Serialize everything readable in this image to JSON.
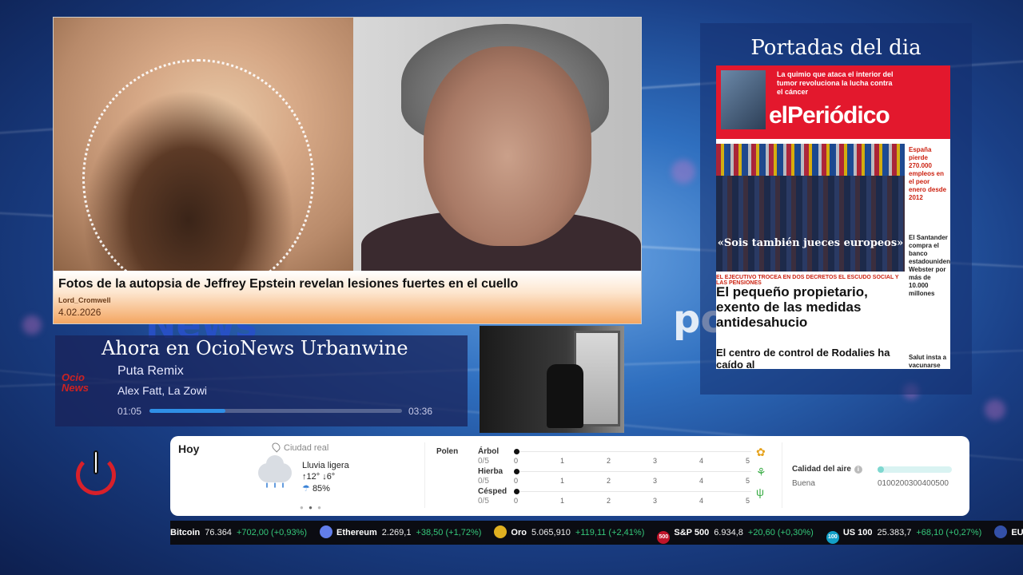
{
  "background": {
    "words": [
      "News",
      "po"
    ]
  },
  "news": {
    "headline": "Fotos de la autopsia de Jeffrey Epstein revelan lesiones fuertes en el cuello",
    "author": "Lord_Cromwell",
    "date": "4.02.2026"
  },
  "portadas": {
    "title": "Portadas del dia",
    "paper": {
      "logo": "elPeriódico",
      "teaser": "La quimio que ataca el interior del tumor revoluciona la lucha contra el cáncer",
      "photo_quote": "«Sois también jueces europeos»",
      "side_1": "España pierde 270.000 empleos en el peor enero desde 2012",
      "side_2": "El Santander compra el banco estadounidense Webster por más de 10.000 millones",
      "side_3": "Salut insta a vacunarse de sarampión a los",
      "section": "EL EJECUTIVO TROCEA EN DOS DECRETOS EL ESCUDO SOCIAL Y LAS PENSIONES",
      "main_headline": "El pequeño propietario, exento de las medidas antidesahucio",
      "second_headline": "El centro de control de Rodalies ha caído al"
    }
  },
  "now_playing": {
    "title": "Ahora en OcioNews Urbanwine",
    "logo_text": "Ocio News",
    "track": "Puta Remix",
    "artist": "Alex Fatt, La Zowi",
    "time_current": "01:05",
    "time_total": "03:36",
    "progress": 0.3
  },
  "weather": {
    "day": "Hoy",
    "location": "Ciudad real",
    "condition": "Lluvia ligera",
    "temp": "↑12° ↓6°",
    "humidity": "85%",
    "polen_label": "Polen",
    "polen": [
      {
        "name": "Árbol",
        "value": "0/5"
      },
      {
        "name": "Hierba",
        "value": "0/5"
      },
      {
        "name": "Césped",
        "value": "0/5"
      }
    ],
    "polen_scale": [
      "0",
      "1",
      "2",
      "3",
      "4",
      "5"
    ],
    "air_label": "Calidad del aire",
    "air_status": "Buena",
    "air_scale": "0100200300400500"
  },
  "ticker": [
    {
      "name": "Bitcoin",
      "price": "76.364",
      "change": "+702,00 (+0,93%)",
      "icon": "",
      "color": "#f7931a"
    },
    {
      "name": "Ethereum",
      "price": "2.269,1",
      "change": "+38,50 (+1,72%)",
      "icon": "",
      "color": "#627eea"
    },
    {
      "name": "Oro",
      "price": "5.065,910",
      "change": "+119,11 (+2,41%)",
      "icon": "",
      "color": "#e0b020"
    },
    {
      "name": "S&P 500",
      "price": "6.934,8",
      "change": "+20,60 (+0,30%)",
      "icon": "500",
      "color": "#c0142a"
    },
    {
      "name": "US 100",
      "price": "25.383,7",
      "change": "+68,10 (+0,27%)",
      "icon": "100",
      "color": "#13a0c8"
    },
    {
      "name": "EU",
      "price": "",
      "change": "",
      "icon": "",
      "color": "#3350a8"
    }
  ],
  "colors": {
    "accent_orange": "#f3a35c",
    "paper_red": "#e3182d",
    "progress_blue": "#2f8fe6",
    "ticker_green": "#35c77a",
    "power_red": "#d8202a"
  }
}
